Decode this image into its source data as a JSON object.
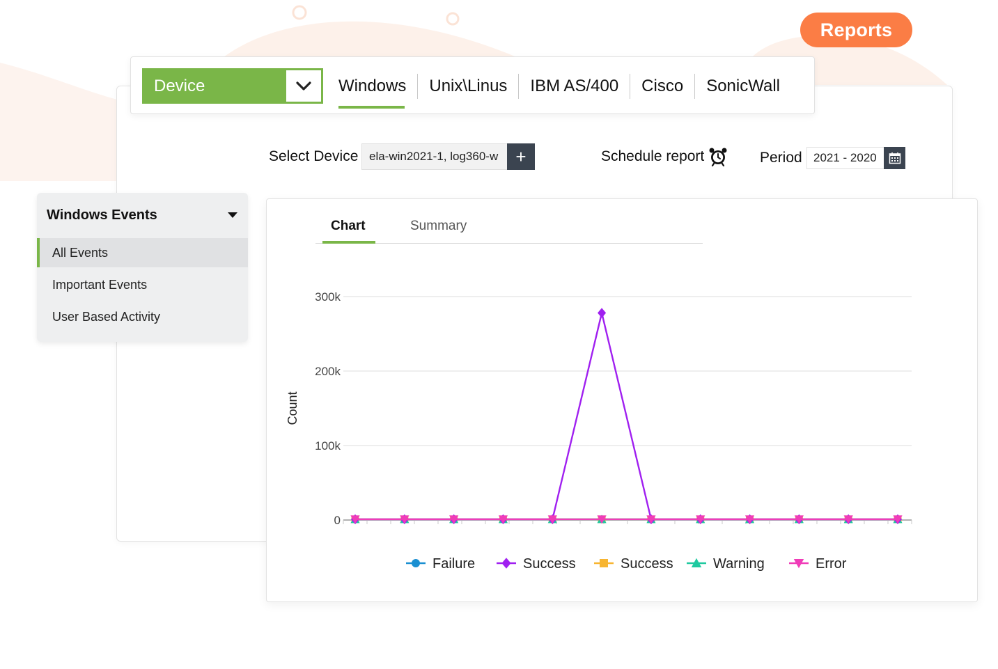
{
  "header": {
    "reports_label": "Reports"
  },
  "device_selector": {
    "label": "Device"
  },
  "os_tabs": [
    {
      "label": "Windows",
      "active": true
    },
    {
      "label": "Unix\\Linus",
      "active": false
    },
    {
      "label": "IBM AS/400",
      "active": false
    },
    {
      "label": "Cisco",
      "active": false
    },
    {
      "label": "SonicWall",
      "active": false
    }
  ],
  "filters": {
    "select_device_label": "Select Device",
    "device_value": "ela-win2021-1, log360-w",
    "add_label": "+",
    "schedule_label": "Schedule report",
    "period_label": "Period",
    "period_value": "2021 - 2020"
  },
  "sidebar": {
    "title": "Windows Events",
    "items": [
      {
        "label": "All Events",
        "active": true
      },
      {
        "label": "Important Events",
        "active": false
      },
      {
        "label": "User Based Activity",
        "active": false
      }
    ]
  },
  "chart_tabs": [
    {
      "label": "Chart",
      "active": true
    },
    {
      "label": "Summary",
      "active": false
    }
  ],
  "colors": {
    "accent_green": "#7ab648",
    "reports_orange": "#fb7d45",
    "dark_button": "#3b4450"
  },
  "chart_data": {
    "type": "line",
    "ylabel": "Count",
    "xlabel": "",
    "ylim": [
      0,
      300000
    ],
    "yticks": [
      0,
      100000,
      200000,
      300000
    ],
    "ytick_labels": [
      "0",
      "100k",
      "200k",
      "300k"
    ],
    "grid": true,
    "legend_position": "bottom",
    "x": [
      1,
      2,
      3,
      4,
      5,
      6,
      7,
      8,
      9,
      10,
      11,
      12
    ],
    "series": [
      {
        "name": "Failure",
        "color": "#1a8fd1",
        "marker": "circle",
        "values": [
          1000,
          1000,
          1000,
          1000,
          1000,
          1000,
          1000,
          1000,
          1000,
          1000,
          1000,
          1000
        ]
      },
      {
        "name": "Success",
        "color": "#a020f0",
        "marker": "diamond",
        "values": [
          1000,
          1000,
          1000,
          1000,
          1000,
          278000,
          1000,
          1000,
          1000,
          1000,
          1000,
          1000
        ]
      },
      {
        "name": "Success",
        "color": "#f7b531",
        "marker": "square",
        "values": [
          1000,
          1000,
          1000,
          1000,
          1000,
          1000,
          1000,
          1000,
          1000,
          1000,
          1000,
          1000
        ]
      },
      {
        "name": "Warning",
        "color": "#1fc9a0",
        "marker": "triangle-up",
        "values": [
          1000,
          1000,
          1000,
          1000,
          1000,
          1000,
          1000,
          1000,
          1000,
          1000,
          1000,
          1000
        ]
      },
      {
        "name": "Error",
        "color": "#f03cb8",
        "marker": "triangle-down",
        "values": [
          1000,
          1000,
          1000,
          1000,
          1000,
          1000,
          1000,
          1000,
          1000,
          1000,
          1000,
          1000
        ]
      }
    ]
  }
}
